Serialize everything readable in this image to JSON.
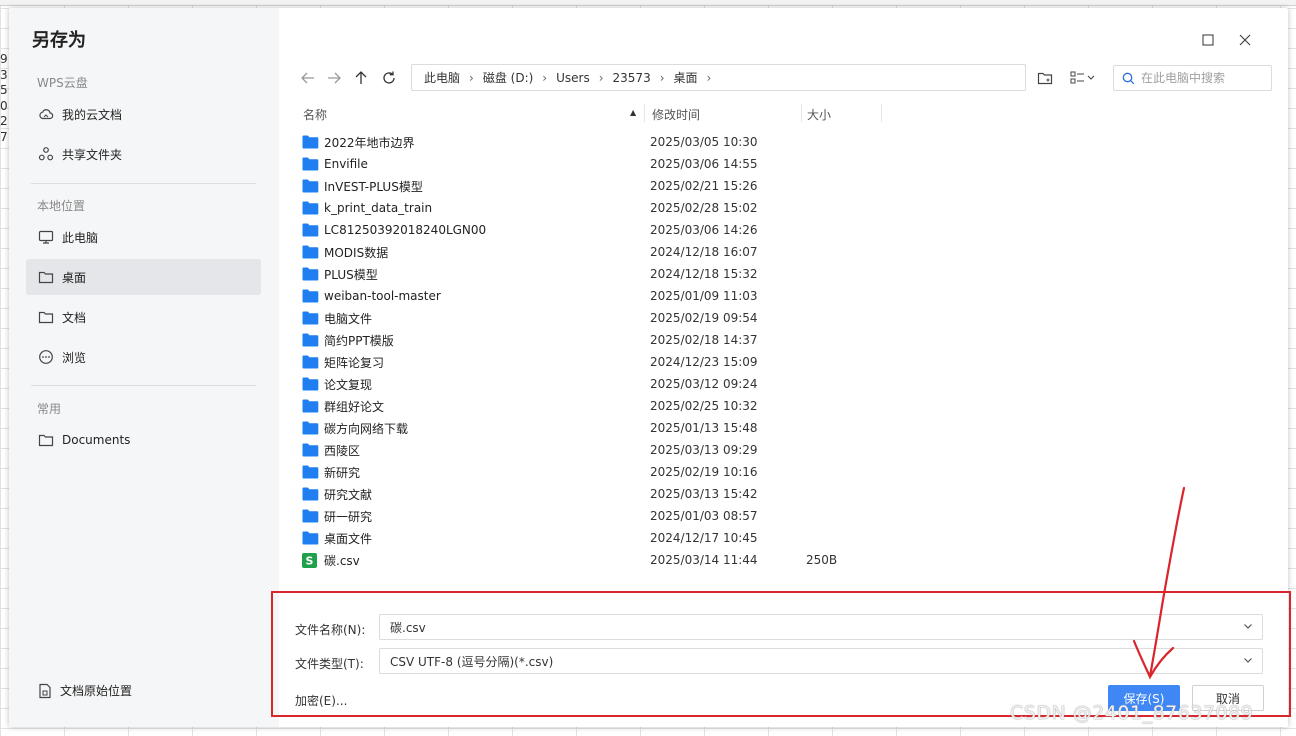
{
  "background": {
    "left_digits": [
      "9",
      "3",
      "5",
      "0",
      "2",
      "7"
    ]
  },
  "dialog": {
    "title": "另存为",
    "sidebar": {
      "cloud_group": "WPS云盘",
      "cloud_items": [
        {
          "label": "我的云文档",
          "icon": "cloud-icon"
        },
        {
          "label": "共享文件夹",
          "icon": "share-icon"
        }
      ],
      "local_group": "本地位置",
      "local_items": [
        {
          "label": "此电脑",
          "icon": "computer-icon"
        },
        {
          "label": "桌面",
          "icon": "folder-icon",
          "active": true
        },
        {
          "label": "文档",
          "icon": "folder-icon"
        },
        {
          "label": "浏览",
          "icon": "more-icon"
        }
      ],
      "common_group": "常用",
      "common_items": [
        {
          "label": "Documents",
          "icon": "folder-icon"
        }
      ],
      "bottom_label": "文档原始位置"
    },
    "breadcrumb": [
      "此电脑",
      "磁盘 (D:)",
      "Users",
      "23573",
      "桌面"
    ],
    "search": {
      "placeholder": "在此电脑中搜索"
    },
    "columns": {
      "name": "名称",
      "modified": "修改时间",
      "size": "大小"
    },
    "files": [
      {
        "name": "2022年地市边界",
        "date": "2025/03/05 10:30",
        "size": "",
        "type": "folder"
      },
      {
        "name": "Envifile",
        "date": "2025/03/06 14:55",
        "size": "",
        "type": "folder"
      },
      {
        "name": "InVEST-PLUS模型",
        "date": "2025/02/21 15:26",
        "size": "",
        "type": "folder"
      },
      {
        "name": "k_print_data_train",
        "date": "2025/02/28 15:02",
        "size": "",
        "type": "folder"
      },
      {
        "name": "LC81250392018240LGN00",
        "date": "2025/03/06 14:26",
        "size": "",
        "type": "folder"
      },
      {
        "name": "MODIS数据",
        "date": "2024/12/18 16:07",
        "size": "",
        "type": "folder"
      },
      {
        "name": "PLUS模型",
        "date": "2024/12/18 15:32",
        "size": "",
        "type": "folder"
      },
      {
        "name": "weiban-tool-master",
        "date": "2025/01/09 11:03",
        "size": "",
        "type": "folder"
      },
      {
        "name": "电脑文件",
        "date": "2025/02/19 09:54",
        "size": "",
        "type": "folder"
      },
      {
        "name": "简约PPT模版",
        "date": "2025/02/18 14:37",
        "size": "",
        "type": "folder"
      },
      {
        "name": "矩阵论复习",
        "date": "2024/12/23 15:09",
        "size": "",
        "type": "folder"
      },
      {
        "name": "论文复现",
        "date": "2025/03/12 09:24",
        "size": "",
        "type": "folder"
      },
      {
        "name": "群组好论文",
        "date": "2025/02/25 10:32",
        "size": "",
        "type": "folder"
      },
      {
        "name": "碳方向网络下载",
        "date": "2025/01/13 15:48",
        "size": "",
        "type": "folder"
      },
      {
        "name": "西陵区",
        "date": "2025/03/13 09:29",
        "size": "",
        "type": "folder"
      },
      {
        "name": "新研究",
        "date": "2025/02/19 10:16",
        "size": "",
        "type": "folder"
      },
      {
        "name": "研究文献",
        "date": "2025/03/13 15:42",
        "size": "",
        "type": "folder"
      },
      {
        "name": "研一研究",
        "date": "2025/01/03 08:57",
        "size": "",
        "type": "folder"
      },
      {
        "name": "桌面文件",
        "date": "2024/12/17 10:45",
        "size": "",
        "type": "folder"
      },
      {
        "name": "碳.csv",
        "date": "2025/03/14 11:44",
        "size": "250B",
        "type": "sheet"
      }
    ],
    "form": {
      "filename_label": "文件名称(N):",
      "filename_value": "碳.csv",
      "filetype_label": "文件类型(T):",
      "filetype_value": "CSV UTF-8 (逗号分隔)(*.csv)",
      "encrypt_label": "加密(E)...",
      "save_label": "保存(S)",
      "cancel_label": "取消"
    }
  },
  "colors": {
    "folder": "#1f7ff0",
    "sheet_icon": "#1fa04a",
    "primary_button": "#3f87f5",
    "annotation_red": "#d9262c"
  },
  "watermark": "CSDN @2401_87637089"
}
